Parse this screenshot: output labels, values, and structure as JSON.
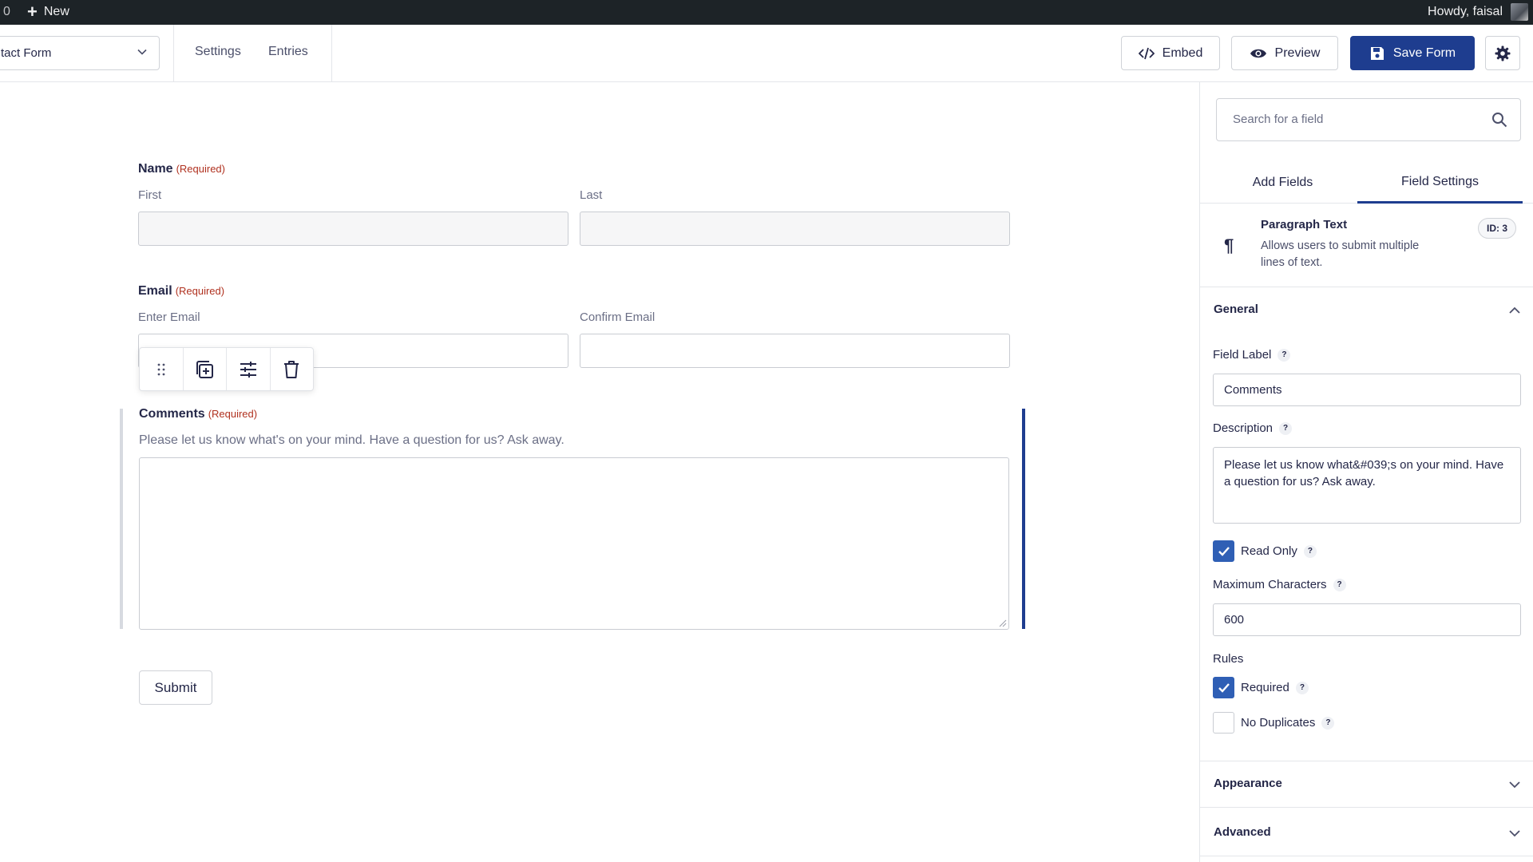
{
  "adminbar": {
    "count": "0",
    "new_label": "New",
    "howdy": "Howdy, faisal"
  },
  "toolbar": {
    "form_name": "tact Form",
    "links": [
      "Settings",
      "Entries"
    ],
    "embed_label": "Embed",
    "preview_label": "Preview",
    "save_label": "Save Form"
  },
  "form": {
    "name_field": {
      "label": "Name",
      "required": "(Required)",
      "first_label": "First",
      "last_label": "Last"
    },
    "email_field": {
      "label": "Email",
      "required": "(Required)",
      "enter_label": "Enter Email",
      "confirm_label": "Confirm Email"
    },
    "comments_field": {
      "label": "Comments",
      "required": "(Required)",
      "description": "Please let us know what's on your mind. Have a question for us? Ask away."
    },
    "submit_label": "Submit"
  },
  "sidebar": {
    "search_placeholder": "Search for a field",
    "tabs": [
      "Add Fields",
      "Field Settings"
    ],
    "active_tab": "Field Settings",
    "field_info": {
      "name": "Paragraph Text",
      "description": "Allows users to submit multiple lines of text.",
      "id_badge": "ID: 3"
    },
    "general": {
      "title": "General",
      "field_label_title": "Field Label",
      "field_label_value": "Comments",
      "description_title": "Description",
      "description_value": "Please let us know what&#039;s on your mind. Have a question for us? Ask away.",
      "read_only_label": "Read Only",
      "read_only_checked": true,
      "max_chars_title": "Maximum Characters",
      "max_chars_value": "600",
      "rules_title": "Rules",
      "required_label": "Required",
      "required_checked": true,
      "no_duplicates_label": "No Duplicates",
      "no_duplicates_checked": false,
      "help_mark": "?"
    },
    "appearance_title": "Appearance",
    "advanced_title": "Advanced"
  },
  "colors": {
    "accent": "#1e3d8f",
    "required": "#b0311f",
    "adminbar": "#1d2327",
    "checkbox": "#2f5fb5"
  }
}
